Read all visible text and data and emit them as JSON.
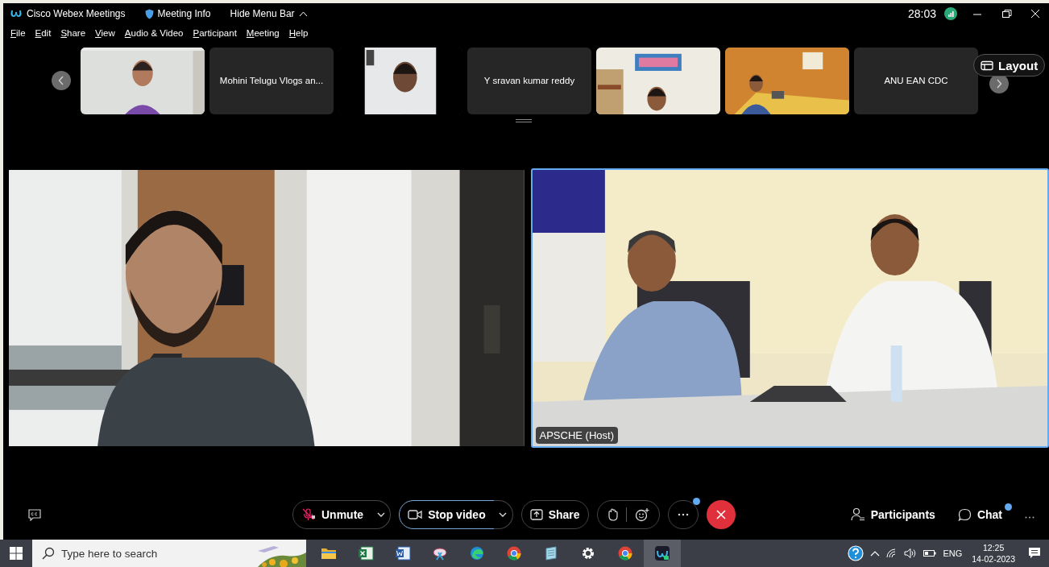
{
  "title_bar": {
    "app_name": "Cisco Webex Meetings",
    "meeting_info": "Meeting Info",
    "hide_menu": "Hide Menu Bar",
    "timer": "28:03"
  },
  "menu": [
    "File",
    "Edit",
    "Share",
    "View",
    "Audio & Video",
    "Participant",
    "Meeting",
    "Help"
  ],
  "thumbnails": [
    {
      "kind": "video"
    },
    {
      "kind": "name",
      "name": "Mohini Telugu Vlogs an..."
    },
    {
      "kind": "video"
    },
    {
      "kind": "name",
      "name": "Y sravan kumar reddy"
    },
    {
      "kind": "video"
    },
    {
      "kind": "video"
    },
    {
      "kind": "name",
      "name": "ANU EAN CDC"
    }
  ],
  "layout_button": "Layout",
  "main_videos": [
    {
      "kind": "video",
      "active_speaker": false
    },
    {
      "kind": "video",
      "active_speaker": true,
      "label": "APSCHE (Host)"
    }
  ],
  "controls": {
    "mute": {
      "label": "Unmute",
      "muted": true
    },
    "video": {
      "label": "Stop video",
      "focused": true
    },
    "share": "Share",
    "more_badge": true,
    "participants": "Participants",
    "chat": {
      "label": "Chat",
      "unread": true
    }
  },
  "taskbar": {
    "search_placeholder": "Type here to search",
    "apps": [
      {
        "kind": "folder",
        "selected": false
      },
      {
        "kind": "sheet",
        "selected": false
      },
      {
        "kind": "doc",
        "selected": false
      },
      {
        "kind": "snip",
        "selected": false
      },
      {
        "kind": "edge",
        "selected": false
      },
      {
        "kind": "chrome",
        "selected": false
      },
      {
        "kind": "notepad",
        "selected": false
      },
      {
        "kind": "gear",
        "selected": false
      },
      {
        "kind": "chrome",
        "selected": false
      },
      {
        "kind": "webex",
        "selected": true
      }
    ],
    "language": "ENG",
    "time": "12:25",
    "date": "14-02-2023"
  }
}
